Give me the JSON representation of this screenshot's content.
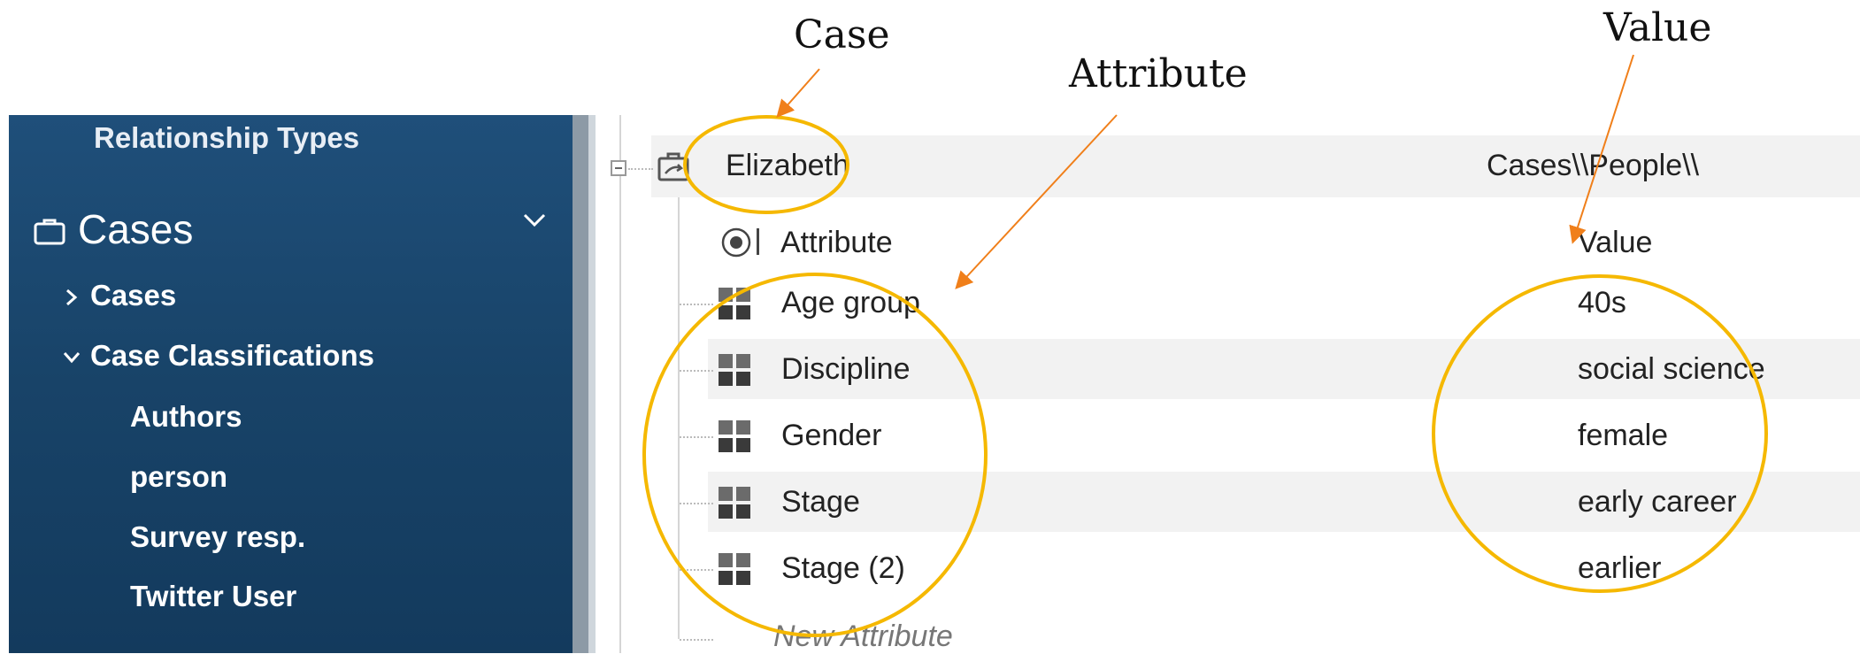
{
  "annotations": {
    "case": "Case",
    "attribute": "Attribute",
    "value": "Value"
  },
  "sidebar": {
    "relationship_types": "Relationship Types",
    "section_title": "Cases",
    "items": [
      {
        "label": "Cases",
        "expanded": false
      },
      {
        "label": "Case Classifications",
        "expanded": true
      }
    ],
    "classifications": [
      "Authors",
      "person",
      "Survey resp.",
      "Twitter User"
    ]
  },
  "case": {
    "name": "Elizabeth",
    "path": "Cases\\\\People\\\\"
  },
  "table": {
    "header_attribute": "Attribute",
    "header_value": "Value",
    "rows": [
      {
        "attribute": "Age group",
        "value": "40s"
      },
      {
        "attribute": "Discipline",
        "value": "social science"
      },
      {
        "attribute": "Gender",
        "value": "female"
      },
      {
        "attribute": "Stage",
        "value": "early career"
      },
      {
        "attribute": "Stage (2)",
        "value": "earlier"
      }
    ],
    "new_attribute": "New Attribute"
  },
  "colors": {
    "sidebar_bg": "#184368",
    "highlight_circle": "#f5b800",
    "arrow": "#f07f1a"
  }
}
